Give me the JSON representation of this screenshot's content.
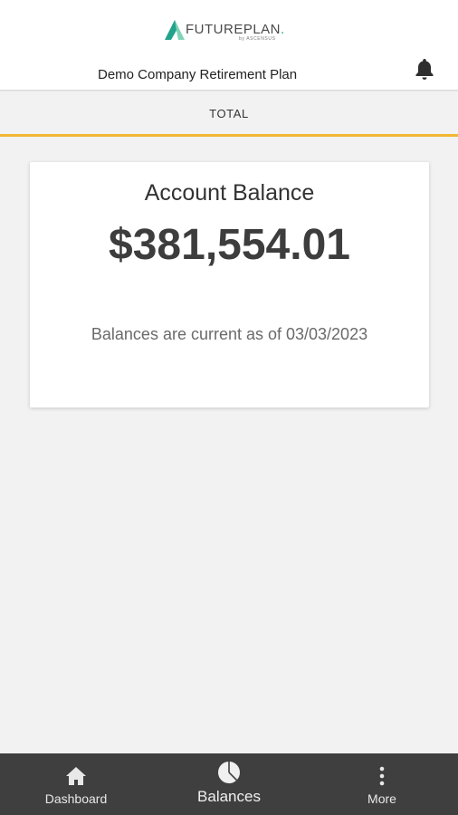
{
  "header": {
    "logo_text_main": "FUTUREPLAN",
    "logo_text_dot": ".",
    "logo_subtext": "by ASCENSUS",
    "plan_name": "Demo Company Retirement Plan",
    "bell_icon": "bell-icon"
  },
  "tabs": [
    {
      "label": "TOTAL",
      "active": true
    }
  ],
  "colors": {
    "accent": "#f2b632",
    "logo_green": "#22a38b",
    "nav_bg": "#3f3f3f",
    "page_bg": "#f2f2f2"
  },
  "card": {
    "title": "Account Balance",
    "amount": "$381,554.01",
    "note": "Balances are current as of 03/03/2023"
  },
  "bottom_nav": [
    {
      "label": "Dashboard",
      "icon": "home-icon",
      "active": false
    },
    {
      "label": "Balances",
      "icon": "pie-chart-icon",
      "active": true
    },
    {
      "label": "More",
      "icon": "more-vertical-icon",
      "active": false
    }
  ]
}
